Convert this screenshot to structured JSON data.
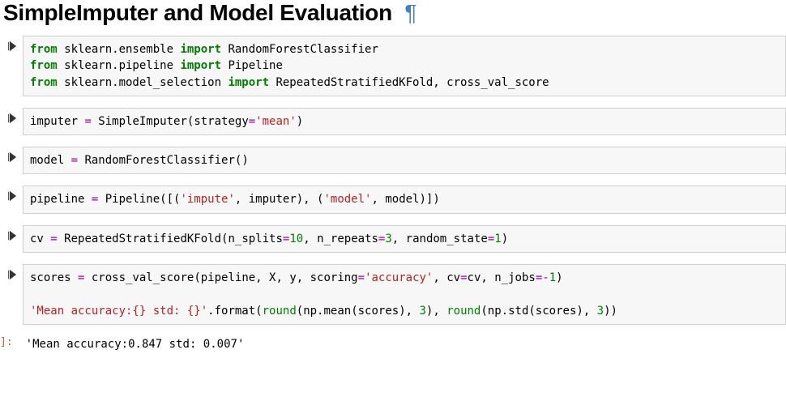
{
  "title": "SimpleImputer and Model Evaluation",
  "pilcrow": "¶",
  "cells": {
    "c1": {
      "l1a": "from",
      "l1b": " sklearn.ensemble ",
      "l1c": "import",
      "l1d": " RandomForestClassifier",
      "l2a": "from",
      "l2b": " sklearn.pipeline ",
      "l2c": "import",
      "l2d": " Pipeline",
      "l3a": "from",
      "l3b": " sklearn.model_selection ",
      "l3c": "import",
      "l3d": " RepeatedStratifiedKFold, cross_val_score"
    },
    "c2": {
      "a": "imputer ",
      "eq": "=",
      "b": " SimpleImputer",
      "lp": "(",
      "kw": "strategy",
      "eq2": "=",
      "s": "'mean'",
      "rp": ")"
    },
    "c3": {
      "a": "model ",
      "eq": "=",
      "b": " RandomForestClassifier",
      "lp": "(",
      "rp": ")"
    },
    "c4": {
      "a": "pipeline ",
      "eq": "=",
      "b": " Pipeline",
      "lp": "([(",
      "s1": "'impute'",
      "c1": ", imputer",
      "rp1": "), (",
      "s2": "'model'",
      "c2": ", model",
      "rp2": ")])"
    },
    "c5": {
      "a": "cv ",
      "eq": "=",
      "b": " RepeatedStratifiedKFold",
      "lp": "(",
      "k1": "n_splits",
      "e1": "=",
      "v1": "10",
      "c1": ", ",
      "k2": "n_repeats",
      "e2": "=",
      "v2": "3",
      "c2": ", ",
      "k3": "random_state",
      "e3": "=",
      "v3": "1",
      "rp": ")"
    },
    "c6": {
      "l1a": "scores ",
      "l1eq": "=",
      "l1b": " cross_val_score",
      "l1lp": "(",
      "l1c": "pipeline, X, y, ",
      "l1k1": "scoring",
      "l1e1": "=",
      "l1s1": "'accuracy'",
      "l1c2": ", ",
      "l1k2": "cv",
      "l1e2": "=",
      "l1v2": "cv, ",
      "l1k3": "n_jobs",
      "l1e3": "=",
      "l1eqn": "-",
      "l1vn": "1",
      "l1rp": ")",
      "blank": "",
      "l2s": "'Mean accuracy:{} std: {}'",
      "l2a": ".format",
      "l2lp": "(",
      "l2r1": "round",
      "l2p1": "(np.mean(scores), ",
      "l2n1": "3",
      "l2rp1": "), ",
      "l2r2": "round",
      "l2p2": "(np.std(scores), ",
      "l2n2": "3",
      "l2rp2": "))"
    }
  },
  "output": {
    "prompt": "]:",
    "text": "'Mean accuracy:0.847 std: 0.007'"
  }
}
